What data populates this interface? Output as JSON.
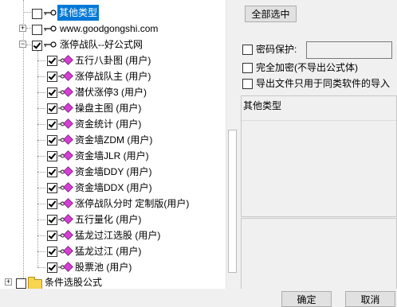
{
  "tree": {
    "root_items": [
      {
        "label": "其他类型",
        "selected": true,
        "checked": false
      },
      {
        "label": "www.goodgongshi.com",
        "checked": false
      },
      {
        "label": "涨停战队--好公式网",
        "checked": true
      }
    ],
    "children": [
      "五行八卦图 (用户)",
      "涨停战队主 (用户)",
      "潜伏涨停3 (用户)",
      "操盘主图 (用户)",
      "资金统计 (用户)",
      "资金墙ZDM (用户)",
      "资金墙JLR (用户)",
      "资金墙DDY (用户)",
      "资金墙DDX (用户)",
      "涨停战队分时 定制版(用户)",
      "五行量化 (用户)",
      "猛龙过江选股 (用户)",
      "猛龙过江 (用户)",
      "股票池 (用户)"
    ],
    "folder_item": {
      "label": "条件选股公式",
      "checked": false
    }
  },
  "right": {
    "select_all_label": "全部选中",
    "password_label": "密码保护:",
    "password_value": "",
    "full_encrypt_label": "完全加密(不导出公式体)",
    "same_type_label": "导出文件只用于同类软件的导入",
    "type_header": "其他类型"
  },
  "buttons": {
    "ok_label": "确定",
    "cancel_label": "取消"
  },
  "colors": {
    "selection": "#0078d7",
    "formula_icon": "#d63fd6",
    "folder": "#f7d54f"
  }
}
